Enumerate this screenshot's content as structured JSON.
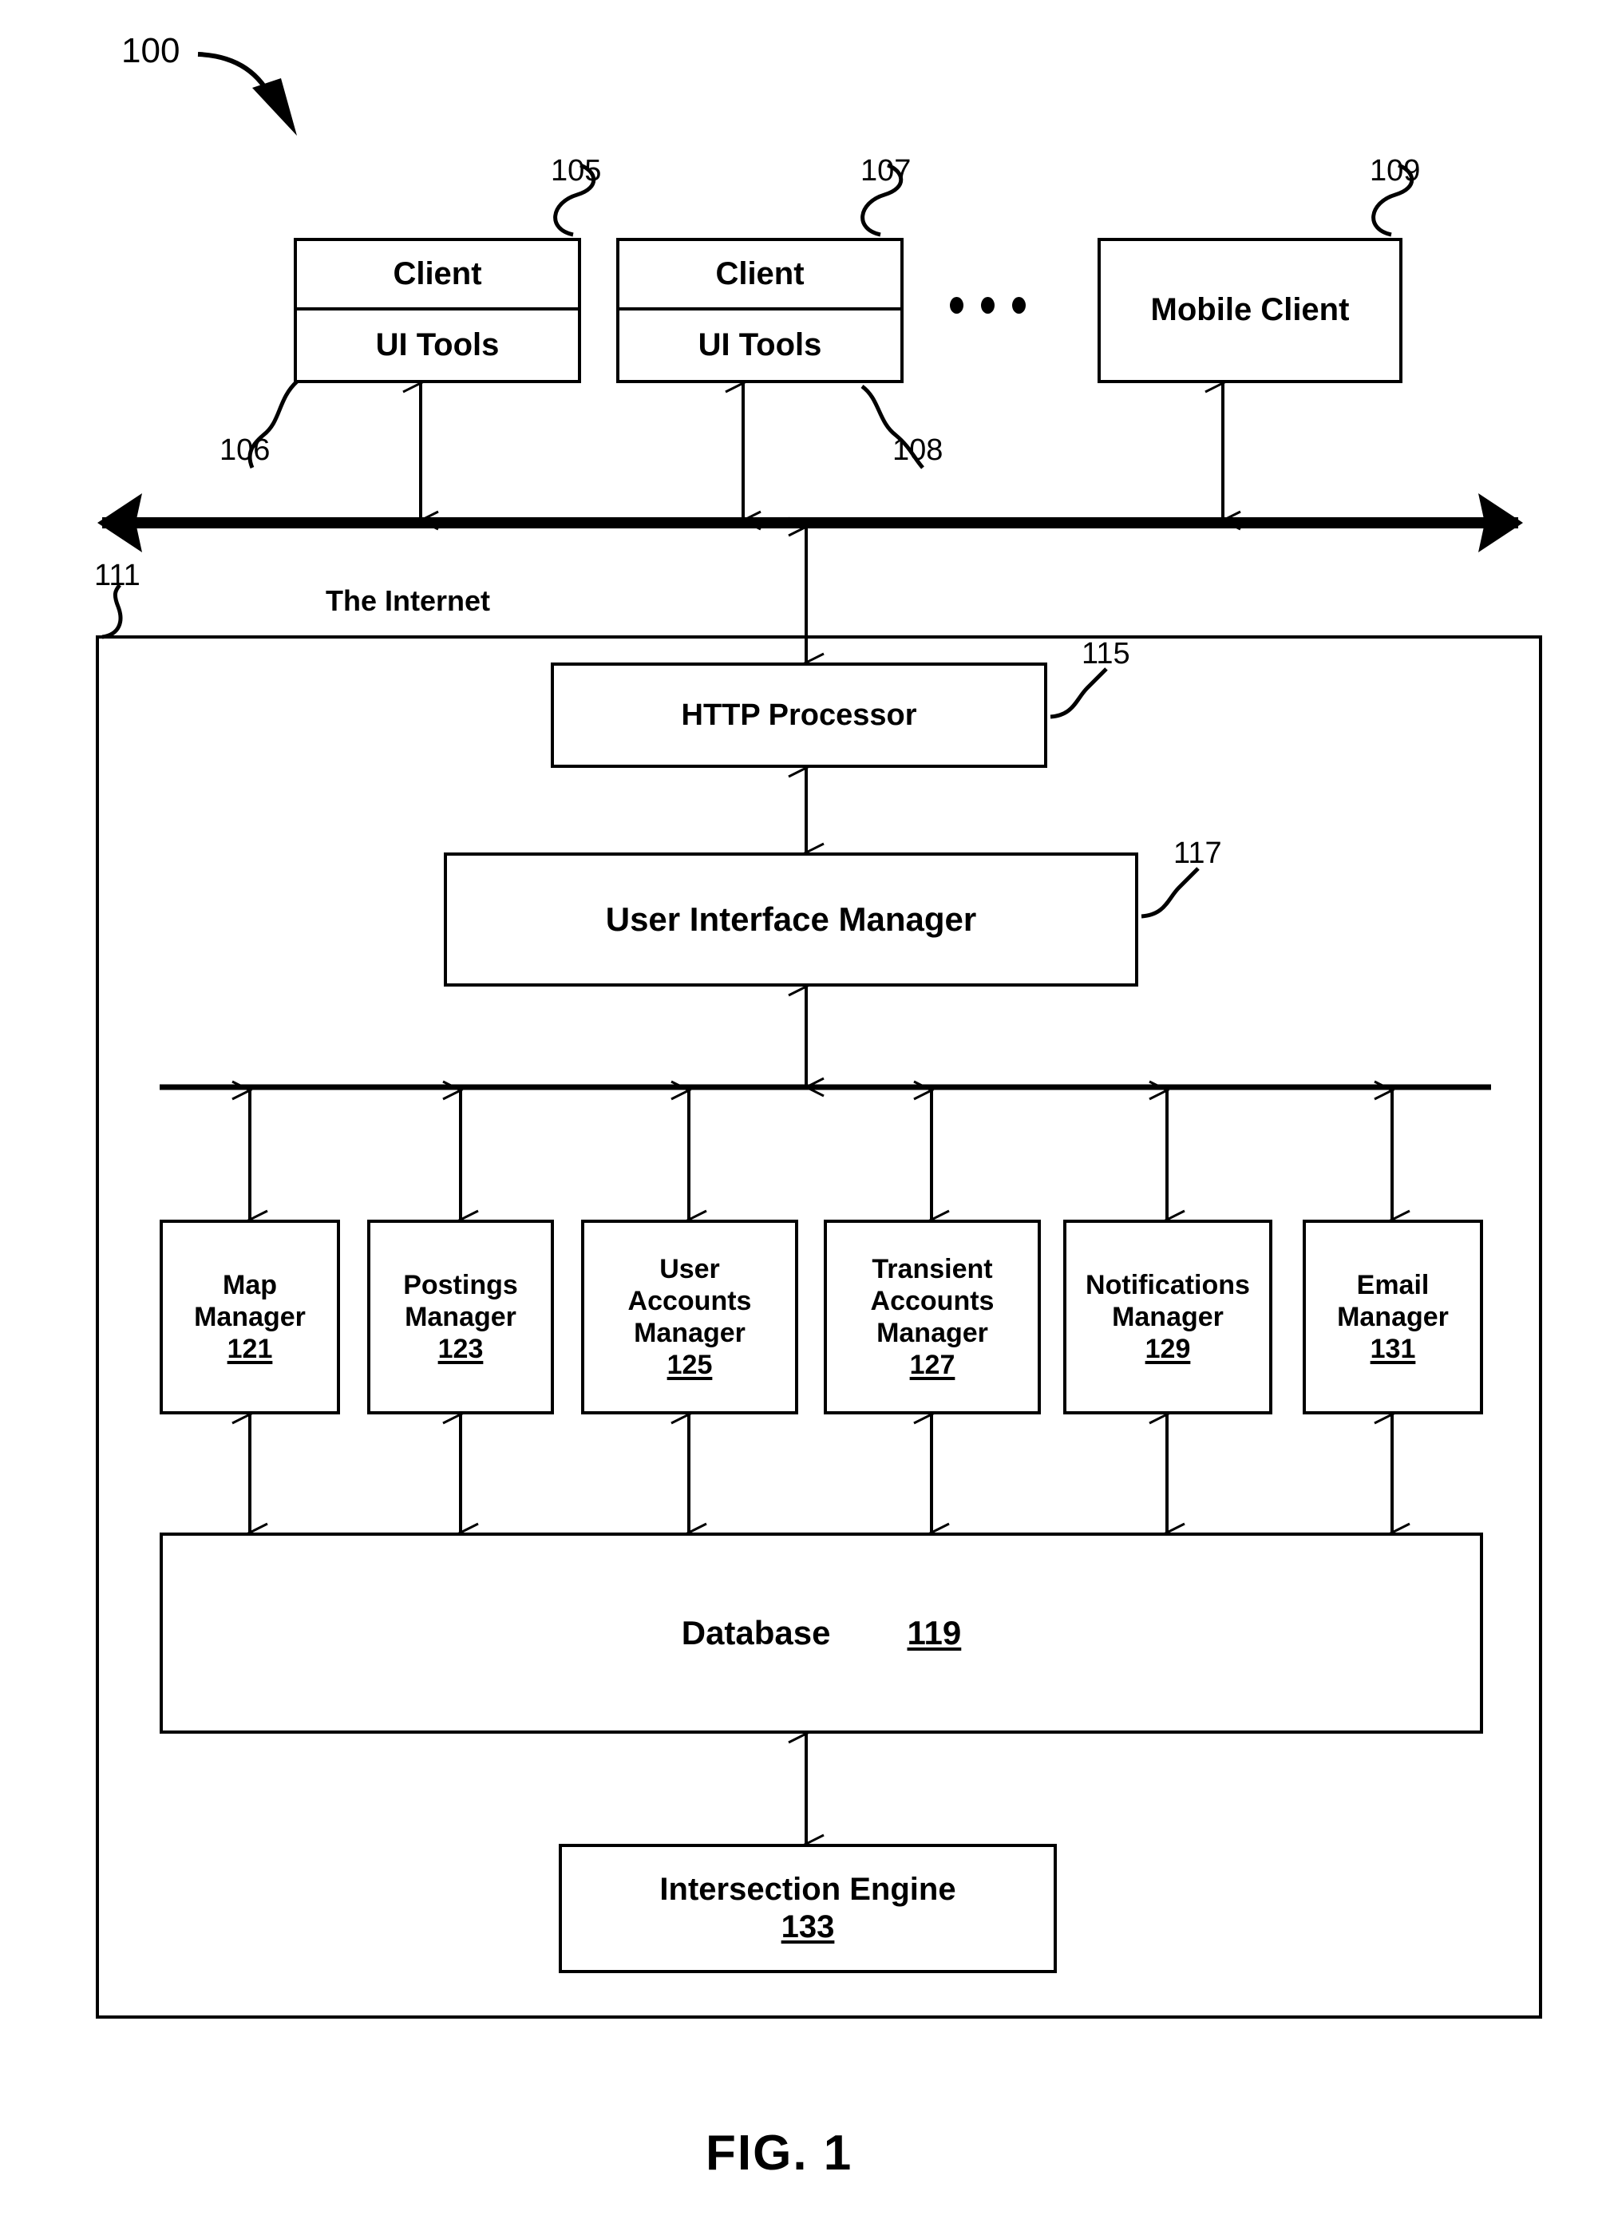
{
  "figure": {
    "caption": "FIG. 1",
    "system_ref": "100"
  },
  "clients": [
    {
      "ref": "105",
      "title": "Client",
      "subtitle": "UI Tools",
      "sub_ref": "106"
    },
    {
      "ref": "107",
      "title": "Client",
      "subtitle": "UI Tools",
      "sub_ref": "108"
    }
  ],
  "ellipsis": "• • •",
  "mobile_client": {
    "ref": "109",
    "title": "Mobile Client"
  },
  "network": {
    "label": "The Internet",
    "ref": "111"
  },
  "server": {
    "http_processor": {
      "label": "HTTP Processor",
      "ref": "115"
    },
    "ui_manager": {
      "label": "User Interface Manager",
      "ref": "117"
    },
    "managers": [
      {
        "line1": "Map",
        "line2": "Manager",
        "line3": "",
        "num": "121"
      },
      {
        "line1": "Postings",
        "line2": "Manager",
        "line3": "",
        "num": "123"
      },
      {
        "line1": "User",
        "line2": "Accounts",
        "line3": "Manager",
        "num": "125"
      },
      {
        "line1": "Transient",
        "line2": "Accounts",
        "line3": "Manager",
        "num": "127"
      },
      {
        "line1": "Notifications",
        "line2": "Manager",
        "line3": "",
        "num": "129"
      },
      {
        "line1": "Email",
        "line2": "Manager",
        "line3": "",
        "num": "131"
      }
    ],
    "database": {
      "label": "Database",
      "num": "119"
    },
    "intersection_engine": {
      "label": "Intersection Engine",
      "num": "133"
    }
  },
  "colors": {
    "line": "#000000",
    "background": "#ffffff"
  }
}
